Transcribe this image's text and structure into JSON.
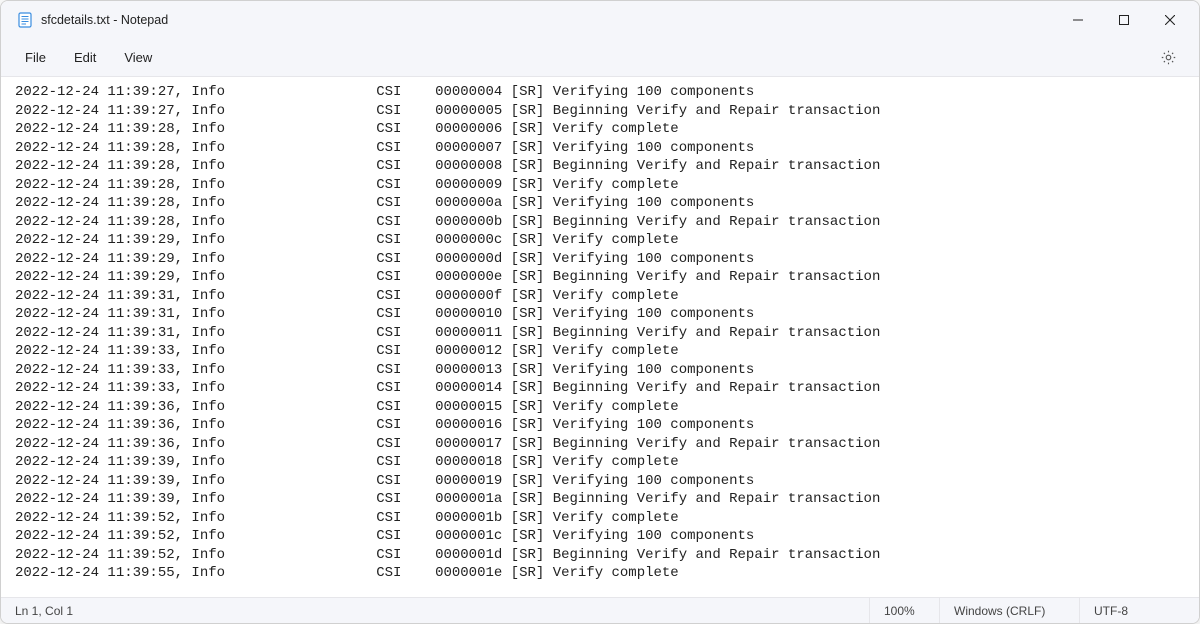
{
  "window": {
    "title": "sfcdetails.txt - Notepad"
  },
  "menu": {
    "file": "File",
    "edit": "Edit",
    "view": "View"
  },
  "log_lines": [
    "2022-12-24 11:39:27, Info                  CSI    00000004 [SR] Verifying 100 components",
    "2022-12-24 11:39:27, Info                  CSI    00000005 [SR] Beginning Verify and Repair transaction",
    "2022-12-24 11:39:28, Info                  CSI    00000006 [SR] Verify complete",
    "2022-12-24 11:39:28, Info                  CSI    00000007 [SR] Verifying 100 components",
    "2022-12-24 11:39:28, Info                  CSI    00000008 [SR] Beginning Verify and Repair transaction",
    "2022-12-24 11:39:28, Info                  CSI    00000009 [SR] Verify complete",
    "2022-12-24 11:39:28, Info                  CSI    0000000a [SR] Verifying 100 components",
    "2022-12-24 11:39:28, Info                  CSI    0000000b [SR] Beginning Verify and Repair transaction",
    "2022-12-24 11:39:29, Info                  CSI    0000000c [SR] Verify complete",
    "2022-12-24 11:39:29, Info                  CSI    0000000d [SR] Verifying 100 components",
    "2022-12-24 11:39:29, Info                  CSI    0000000e [SR] Beginning Verify and Repair transaction",
    "2022-12-24 11:39:31, Info                  CSI    0000000f [SR] Verify complete",
    "2022-12-24 11:39:31, Info                  CSI    00000010 [SR] Verifying 100 components",
    "2022-12-24 11:39:31, Info                  CSI    00000011 [SR] Beginning Verify and Repair transaction",
    "2022-12-24 11:39:33, Info                  CSI    00000012 [SR] Verify complete",
    "2022-12-24 11:39:33, Info                  CSI    00000013 [SR] Verifying 100 components",
    "2022-12-24 11:39:33, Info                  CSI    00000014 [SR] Beginning Verify and Repair transaction",
    "2022-12-24 11:39:36, Info                  CSI    00000015 [SR] Verify complete",
    "2022-12-24 11:39:36, Info                  CSI    00000016 [SR] Verifying 100 components",
    "2022-12-24 11:39:36, Info                  CSI    00000017 [SR] Beginning Verify and Repair transaction",
    "2022-12-24 11:39:39, Info                  CSI    00000018 [SR] Verify complete",
    "2022-12-24 11:39:39, Info                  CSI    00000019 [SR] Verifying 100 components",
    "2022-12-24 11:39:39, Info                  CSI    0000001a [SR] Beginning Verify and Repair transaction",
    "2022-12-24 11:39:52, Info                  CSI    0000001b [SR] Verify complete",
    "2022-12-24 11:39:52, Info                  CSI    0000001c [SR] Verifying 100 components",
    "2022-12-24 11:39:52, Info                  CSI    0000001d [SR] Beginning Verify and Repair transaction",
    "2022-12-24 11:39:55, Info                  CSI    0000001e [SR] Verify complete"
  ],
  "status": {
    "cursor": "Ln 1, Col 1",
    "zoom": "100%",
    "line_ending": "Windows (CRLF)",
    "encoding": "UTF-8"
  }
}
